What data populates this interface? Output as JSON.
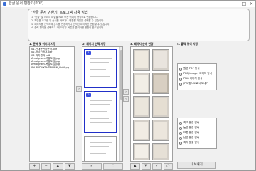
{
  "window": {
    "title": "한글 문서 변환기(PDF)"
  },
  "guide": {
    "title": "'한글 문서 변환기' 프로그램 사용 방법",
    "lines": [
      "1. '한글' 및 이미지 파일을 PDF 또는 이미지 형식으로 변환합니다.",
      "2. 파일을 추가한 뒤 순서를 바꾸거나 변환할 파일을 선택할 수 있습니다.",
      "3. 페이지를 선택하여 순서를 변경하거나 선택한 페이지만 변환할 수 있습니다.",
      "4. 출력 형식을 선택하고 '내보내기' 버튼을 클릭하면 변환이 완료됩니다."
    ]
  },
  "steps": {
    "files": "1. 문서 및 이미지 지정",
    "pages": "2. 페이지 선택 지정",
    "output_pages": "3. 페이지 순서 변경",
    "format": "4. 출력 형식 지정"
  },
  "files": [
    "01-안내문변환문서.pdf",
    "02-상담신청서.pdf",
    "03-처리결과.pdf",
    "Ambigram-복잡도입.jpg",
    "Ambigram-복잡도입.jpg",
    "Ambigram-복잡도입.jpg",
    "IDLBNDUXTHDRLIBN_ShtA.pg"
  ],
  "page_numbers": {
    "p1": "1",
    "p2": "2"
  },
  "buttons": {
    "add": "+",
    "remove": "−",
    "up": "▲",
    "down": "▼",
    "check": "✓",
    "uncheck": "○",
    "right": "›",
    "left": "‹",
    "export": "내보내기"
  },
  "formats": [
    {
      "label": "원본 PDF 형식",
      "selected": false
    },
    {
      "label": "PDF(image) 이미지 형식",
      "selected": true
    },
    {
      "label": "PNG 이미지 형식",
      "selected": false
    },
    {
      "label": "JPG 형식으로 내보내기",
      "selected": false
    }
  ],
  "quality": [
    {
      "label": "최고 품질 압축",
      "selected": true
    },
    {
      "label": "높은 품질 압축",
      "selected": false
    },
    {
      "label": "보통 품질 압축",
      "selected": false
    },
    {
      "label": "낮은 품질 압축",
      "selected": false
    },
    {
      "label": "최저 품질 압축",
      "selected": false
    }
  ]
}
